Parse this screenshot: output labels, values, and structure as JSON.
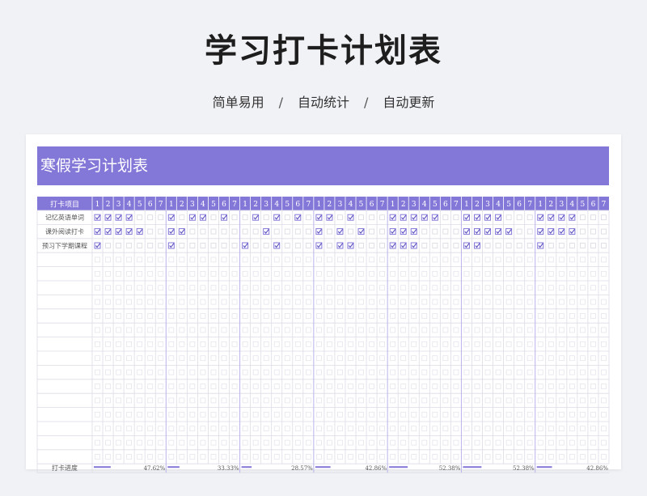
{
  "page": {
    "title": "学习打卡计划表",
    "subtitle": [
      "简单易用",
      "自动统计",
      "自动更新"
    ],
    "separator": "/"
  },
  "sheet": {
    "banner": "寒假学习计划表",
    "item_header": "打卡项目",
    "days": [
      1,
      2,
      3,
      4,
      5,
      6,
      7,
      1,
      2,
      3,
      4,
      5,
      6,
      7,
      1,
      2,
      3,
      4,
      5,
      6,
      7,
      1,
      2,
      3,
      4,
      5,
      6,
      7,
      1,
      2,
      3,
      4,
      5,
      6,
      7,
      1,
      2,
      3,
      4,
      5,
      6,
      7,
      1,
      2,
      3,
      4,
      5,
      6,
      7
    ],
    "tasks": [
      {
        "name": "记忆英语单词",
        "checks": [
          1,
          1,
          1,
          1,
          0,
          0,
          0,
          1,
          0,
          1,
          1,
          0,
          1,
          0,
          0,
          1,
          0,
          1,
          0,
          1,
          0,
          1,
          1,
          0,
          1,
          0,
          0,
          0,
          1,
          1,
          1,
          1,
          1,
          0,
          0,
          1,
          1,
          1,
          1,
          0,
          0,
          0,
          1,
          1,
          1,
          1,
          0,
          0,
          0
        ]
      },
      {
        "name": "课外阅读打卡",
        "checks": [
          1,
          1,
          1,
          1,
          1,
          0,
          0,
          1,
          1,
          0,
          0,
          0,
          0,
          0,
          0,
          0,
          1,
          0,
          0,
          0,
          0,
          1,
          0,
          1,
          0,
          1,
          0,
          0,
          1,
          1,
          1,
          0,
          0,
          0,
          0,
          1,
          1,
          1,
          1,
          1,
          0,
          0,
          1,
          1,
          1,
          1,
          0,
          0,
          0
        ]
      },
      {
        "name": "预习下学期课程",
        "checks": [
          1,
          0,
          0,
          0,
          0,
          0,
          0,
          1,
          0,
          0,
          0,
          0,
          0,
          0,
          1,
          0,
          0,
          1,
          0,
          0,
          0,
          1,
          0,
          1,
          1,
          0,
          0,
          0,
          1,
          1,
          1,
          0,
          0,
          0,
          0,
          1,
          1,
          0,
          0,
          0,
          0,
          0,
          1,
          0,
          0,
          0,
          0,
          0,
          0
        ]
      }
    ],
    "empty_rows": 15,
    "progress_label": "打卡进度",
    "weeks_progress": [
      {
        "percent": 47.62,
        "label": "47.62%"
      },
      {
        "percent": 33.33,
        "label": "33.33%"
      },
      {
        "percent": 28.57,
        "label": "28.57%"
      },
      {
        "percent": 42.86,
        "label": "42.86%"
      },
      {
        "percent": 52.38,
        "label": "52.38%"
      },
      {
        "percent": 52.38,
        "label": "52.38%"
      },
      {
        "percent": 42.86,
        "label": "42.86%"
      }
    ],
    "colors": {
      "accent": "#8377d8",
      "grid": "#dcdce6",
      "divider": "#b9b2ea",
      "text": "#555555"
    }
  }
}
